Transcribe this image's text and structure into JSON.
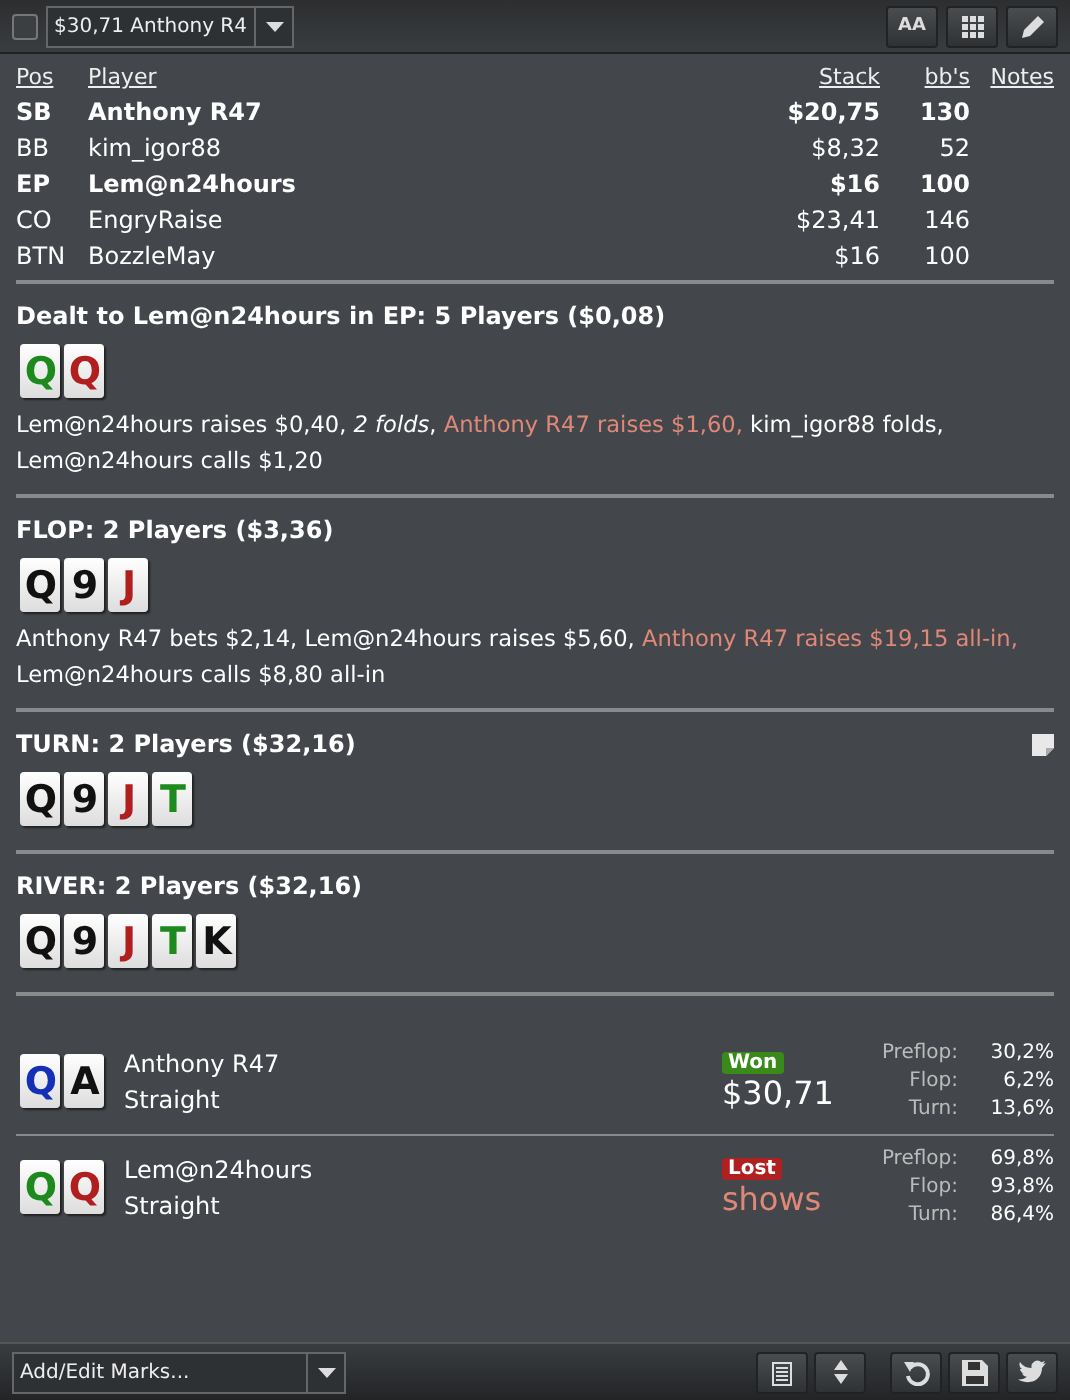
{
  "toolbar": {
    "checked": false,
    "hand_select": "$30,71 Anthony R4",
    "font_button": "AA"
  },
  "players": {
    "columns": [
      "Pos",
      "Player",
      "Stack",
      "bb's",
      "Notes"
    ],
    "rows": [
      {
        "pos": "SB",
        "player": "Anthony R47",
        "stack": "$20,75",
        "bb": "130",
        "highlighted": true
      },
      {
        "pos": "BB",
        "player": "kim_igor88",
        "stack": "$8,32",
        "bb": "52",
        "highlighted": false
      },
      {
        "pos": "EP",
        "player": "Lem@n24hours",
        "stack": "$16",
        "bb": "100",
        "highlighted": true
      },
      {
        "pos": "CO",
        "player": "EngryRaise",
        "stack": "$23,41",
        "bb": "146",
        "highlighted": false
      },
      {
        "pos": "BTN",
        "player": "BozzleMay",
        "stack": "$16",
        "bb": "100",
        "highlighted": false
      }
    ]
  },
  "streets": [
    {
      "title": "Dealt to Lem@n24hours in EP: 5 Players ($0,08)",
      "has_note": false,
      "cards": [
        {
          "rank": "Q",
          "color": "#1d8a1d"
        },
        {
          "rank": "Q",
          "color": "#b01e1e"
        }
      ],
      "actions": [
        {
          "text": "Lem@n24hours raises $0,40, ",
          "kind": "normal"
        },
        {
          "text": "2 folds",
          "kind": "italic"
        },
        {
          "text": ", ",
          "kind": "normal"
        },
        {
          "text": "Anthony R47 raises $1,60, ",
          "kind": "highlight"
        },
        {
          "text": "kim_igor88 folds, Lem@n24hours calls $1,20",
          "kind": "normal"
        }
      ]
    },
    {
      "title": "FLOP: 2 Players ($3,36)",
      "has_note": false,
      "cards": [
        {
          "rank": "Q",
          "color": "#111111"
        },
        {
          "rank": "9",
          "color": "#111111"
        },
        {
          "rank": "J",
          "color": "#b01e1e"
        }
      ],
      "actions": [
        {
          "text": "Anthony R47 bets $2,14, Lem@n24hours raises $5,60, ",
          "kind": "normal"
        },
        {
          "text": "Anthony R47 raises $19,15 all-in,",
          "kind": "highlight"
        },
        {
          "text": " Lem@n24hours calls $8,80 all-in",
          "kind": "normal"
        }
      ]
    },
    {
      "title": "TURN: 2 Players ($32,16)",
      "has_note": true,
      "cards": [
        {
          "rank": "Q",
          "color": "#111111"
        },
        {
          "rank": "9",
          "color": "#111111"
        },
        {
          "rank": "J",
          "color": "#b01e1e"
        },
        {
          "rank": "T",
          "color": "#1d8a1d"
        }
      ]
    },
    {
      "title": "RIVER: 2 Players ($32,16)",
      "has_note": false,
      "cards": [
        {
          "rank": "Q",
          "color": "#111111"
        },
        {
          "rank": "9",
          "color": "#111111"
        },
        {
          "rank": "J",
          "color": "#b01e1e"
        },
        {
          "rank": "T",
          "color": "#1d8a1d"
        },
        {
          "rank": "K",
          "color": "#111111"
        }
      ]
    }
  ],
  "showdown": [
    {
      "cards": [
        {
          "rank": "Q",
          "color": "#1530b4"
        },
        {
          "rank": "A",
          "color": "#111111"
        }
      ],
      "player": "Anthony R47",
      "hand": "Straight",
      "result": {
        "label": "Won",
        "kind": "won"
      },
      "amount": "$30,71",
      "equity": [
        {
          "label": "Preflop:",
          "value": "30,2%"
        },
        {
          "label": "Flop:",
          "value": "6,2%"
        },
        {
          "label": "Turn:",
          "value": "13,6%"
        }
      ]
    },
    {
      "cards": [
        {
          "rank": "Q",
          "color": "#1d8a1d"
        },
        {
          "rank": "Q",
          "color": "#b01e1e"
        }
      ],
      "player": "Lem@n24hours",
      "hand": "Straight",
      "result": {
        "label": "Lost",
        "kind": "lost"
      },
      "amount": "shows",
      "equity": [
        {
          "label": "Preflop:",
          "value": "69,8%"
        },
        {
          "label": "Flop:",
          "value": "93,8%"
        },
        {
          "label": "Turn:",
          "value": "86,4%"
        }
      ]
    }
  ],
  "footer": {
    "marks_select": "Add/Edit Marks..."
  }
}
